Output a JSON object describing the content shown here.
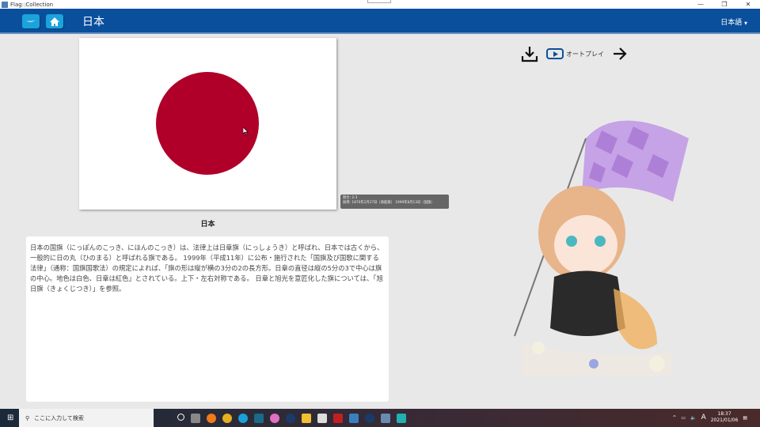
{
  "window": {
    "title": "Flag::Collection",
    "minimize": "—",
    "restore": "❐",
    "close": "✕"
  },
  "header": {
    "title": "日本",
    "language": "日本語",
    "back_icon": "swoosh-back-icon",
    "home_icon": "home-icon"
  },
  "flag": {
    "name": "日本",
    "sun_color": "#b0002a",
    "background": "#ffffff"
  },
  "tooltip": {
    "ratio": "割合: 2:3",
    "adopted": "採用: 1870年2月27日（商船旗） 1999年8月13日（国旗）"
  },
  "description": "日本の国旗（にっぽんのこっき、にほんのこっき）は、法律上は日章旗（にっしょうき）と呼ばれ、日本では古くから、一般的に日の丸（ひのまる）と呼ばれる旗である。 1999年（平成11年）に公布・施行された「国旗及び国歌に関する法律」（通称：国旗国歌法）の規定によれば、「旗の形は縦が横の3分の2の長方形。日章の直径は縦の5分の3で中心は旗の中心。地色は白色、日章は紅色」とされている。上下・左右対称である。 日章と旭光を意匠化した旗については、「旭日旗（きょくじつき）」を参照。",
  "toolbar": {
    "autoplay": "オートプレイ"
  },
  "taskbar": {
    "search_placeholder": "ここに入力して検索",
    "time": "18:37",
    "date": "2021/01/06",
    "ime": "A"
  }
}
